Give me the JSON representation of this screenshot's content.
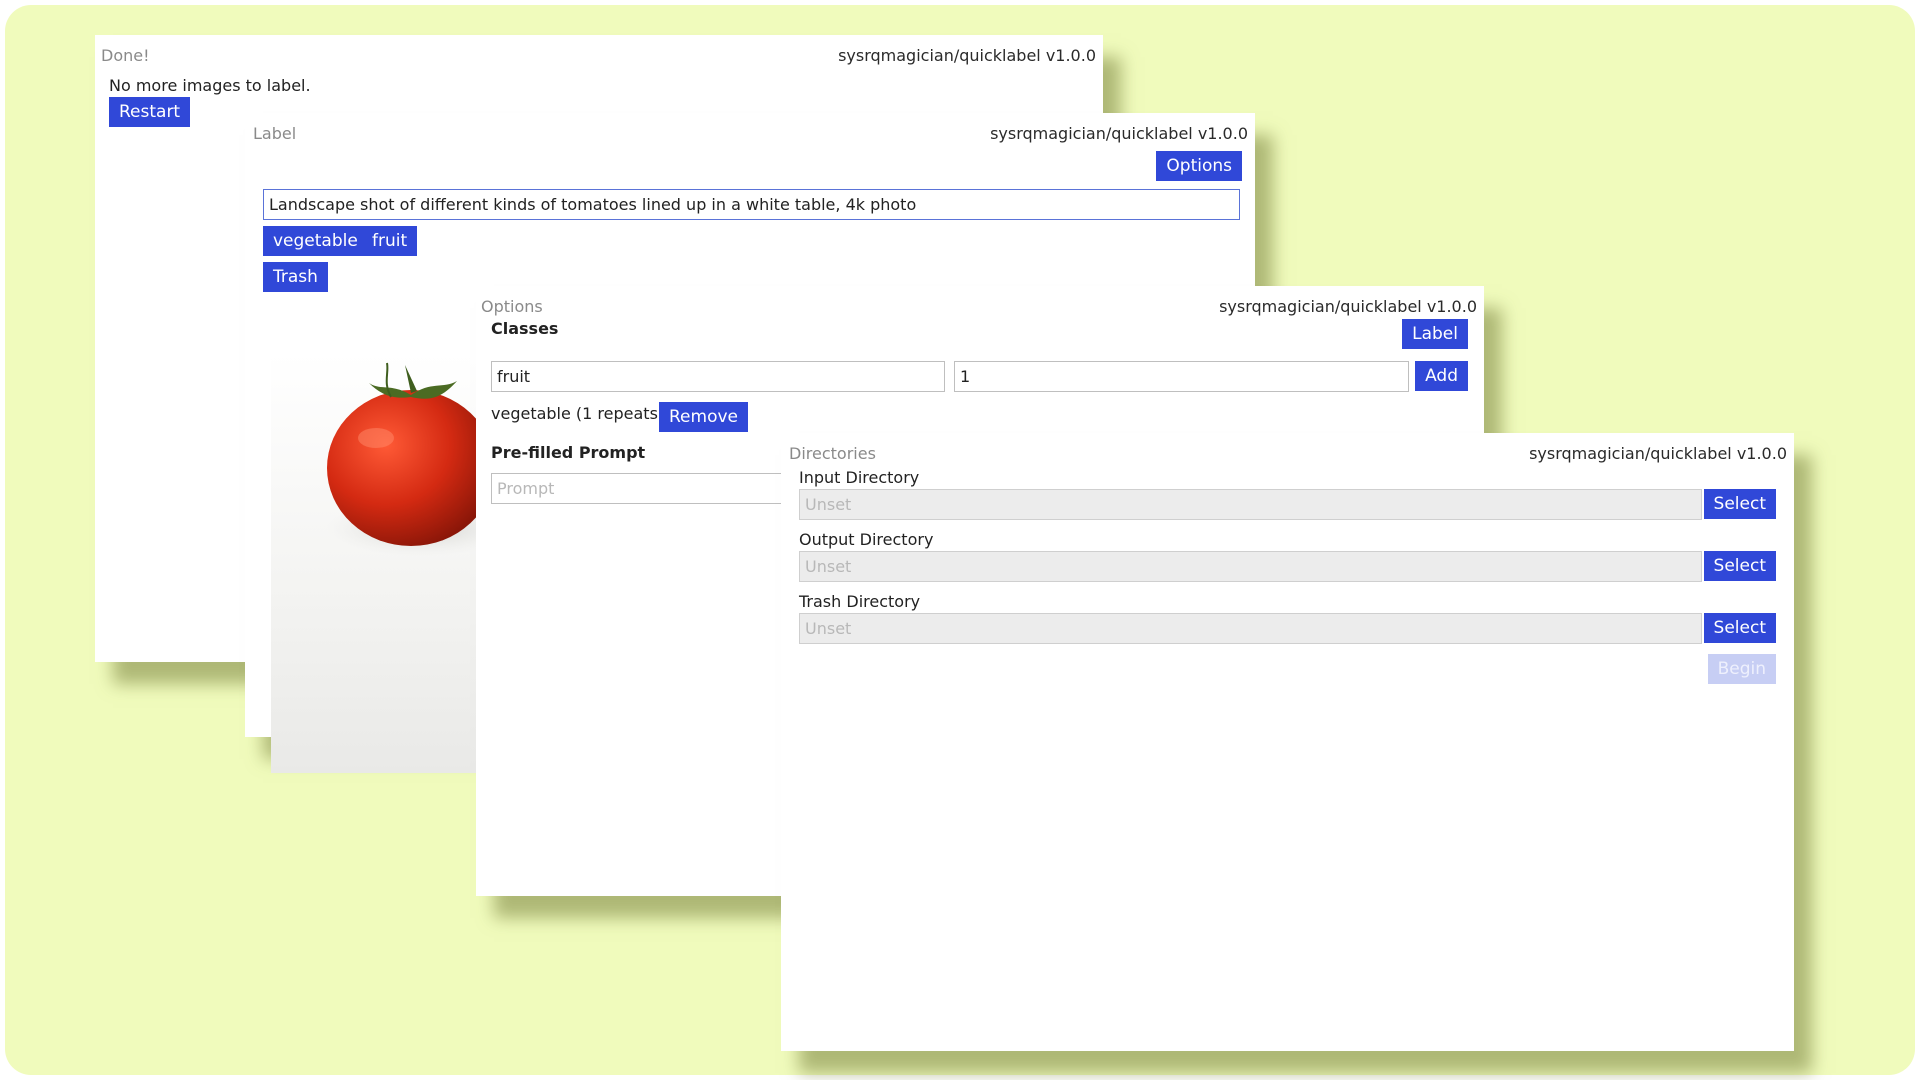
{
  "app_version": "sysrqmagician/quicklabel v1.0.0",
  "done_window": {
    "title": "Done!",
    "message": "No more images to label.",
    "restart_label": "Restart"
  },
  "label_window": {
    "title": "Label",
    "options_label": "Options",
    "caption_value": "Landscape shot of different kinds of tomatoes lined up in a white table, 4k photo",
    "classes": [
      "vegetable",
      "fruit"
    ],
    "trash_label": "Trash"
  },
  "options_window": {
    "title": "Options",
    "classes_heading": "Classes",
    "label_button": "Label",
    "class_name_value": "fruit",
    "repeat_value": "1",
    "add_label": "Add",
    "existing_class_text": "vegetable (1 repeats)",
    "remove_label": "Remove",
    "prefilled_heading": "Pre-filled Prompt",
    "prompt_placeholder": "Prompt"
  },
  "directories_window": {
    "title": "Directories",
    "input_label": "Input Directory",
    "output_label": "Output Directory",
    "trash_label": "Trash Directory",
    "unset_placeholder": "Unset",
    "select_label": "Select",
    "begin_label": "Begin"
  },
  "colors": {
    "background": "#f0fbbc",
    "accent": "#3048d8",
    "disabled_accent": "#c7cef4"
  }
}
